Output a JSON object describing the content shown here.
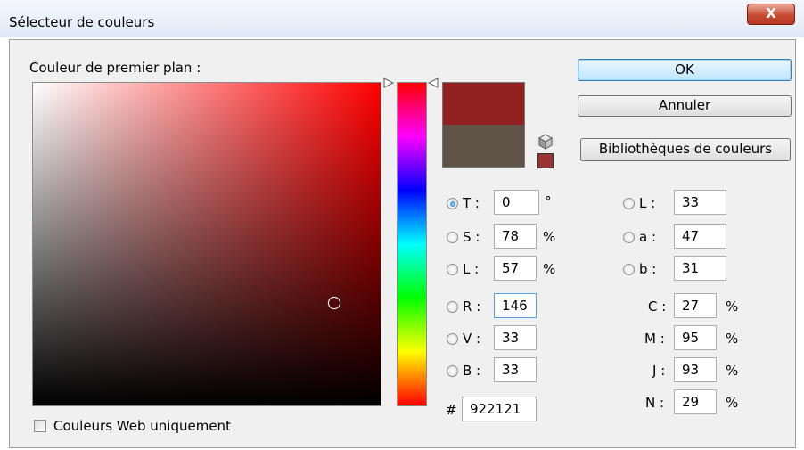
{
  "window": {
    "title": "Sélecteur de couleurs",
    "close_glyph": "X"
  },
  "picker": {
    "foreground_label": "Couleur de premier plan :",
    "new_color": "#922121",
    "current_color": "#5e5346",
    "websafe_color": "#993333"
  },
  "buttons": {
    "ok": "OK",
    "cancel": "Annuler",
    "libraries": "Bibliothèques de couleurs"
  },
  "hsb": {
    "t": {
      "label": "T :",
      "value": "0",
      "unit": "°",
      "selected": true
    },
    "s": {
      "label": "S :",
      "value": "78",
      "unit": "%"
    },
    "l": {
      "label": "L :",
      "value": "57",
      "unit": "%"
    }
  },
  "rgb": {
    "r": {
      "label": "R :",
      "value": "146"
    },
    "v": {
      "label": "V :",
      "value": "33"
    },
    "b": {
      "label": "B :",
      "value": "33"
    }
  },
  "hex": {
    "label": "#",
    "value": "922121"
  },
  "lab": {
    "l": {
      "label": "L :",
      "value": "33"
    },
    "a": {
      "label": "a :",
      "value": "47"
    },
    "b": {
      "label": "b :",
      "value": "31"
    }
  },
  "cmyk": {
    "c": {
      "label": "C :",
      "value": "27",
      "unit": "%"
    },
    "m": {
      "label": "M :",
      "value": "95",
      "unit": "%"
    },
    "j": {
      "label": "J :",
      "value": "93",
      "unit": "%"
    },
    "n": {
      "label": "N :",
      "value": "29",
      "unit": "%"
    }
  },
  "web_only": {
    "label": "Couleurs Web uniquement",
    "checked": false
  },
  "icons": {
    "cube": "cube-icon",
    "close": "close-icon",
    "field_marker": "color-field-marker",
    "slider_arrows": "triangle-arrow-icon"
  }
}
